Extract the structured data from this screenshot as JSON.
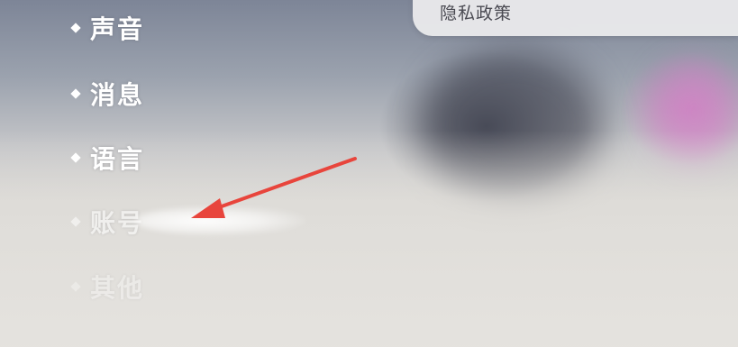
{
  "menu": {
    "privacy_policy": "隐私政策"
  },
  "nav": {
    "items": [
      {
        "label": "声音"
      },
      {
        "label": "消息"
      },
      {
        "label": "语言"
      },
      {
        "label": "账号"
      },
      {
        "label": "其他"
      }
    ]
  },
  "annotation": {
    "arrow_color": "#e8453c"
  }
}
